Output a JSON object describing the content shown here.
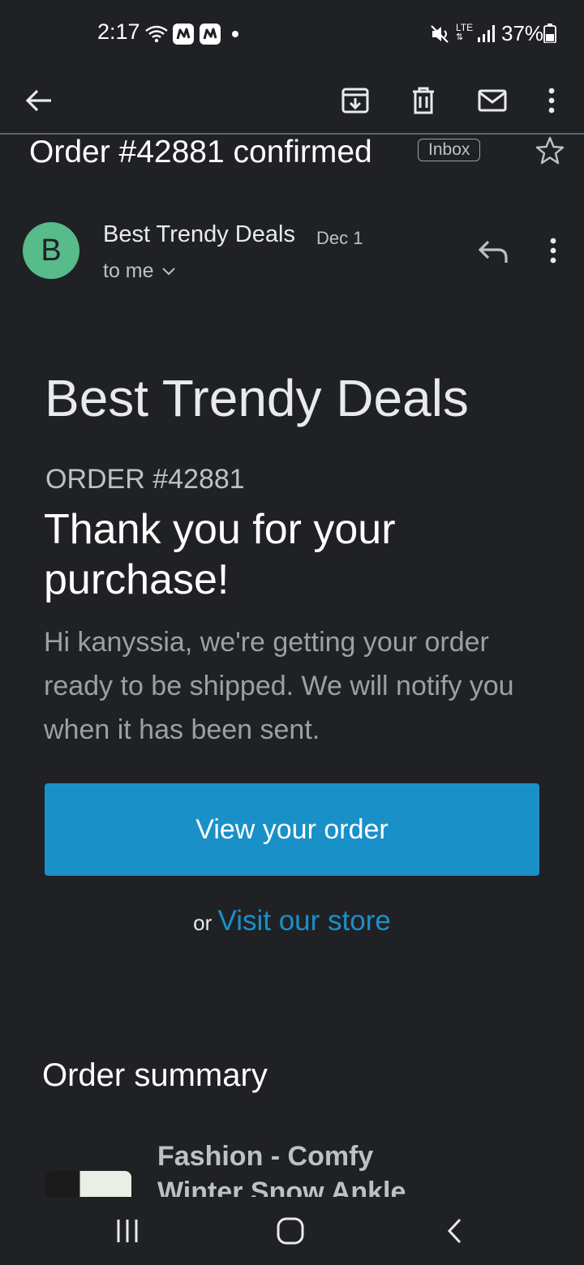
{
  "status_bar": {
    "time": "2:17",
    "network": "LTE",
    "battery": "37%",
    "icons": [
      "wifi-icon",
      "notification-app-icon",
      "notification-app-icon",
      "dot-icon",
      "mute-icon",
      "lte-icon",
      "signal-icon",
      "battery-icon"
    ]
  },
  "toolbar": {
    "back_icon": "arrow-left-icon",
    "actions": [
      "archive-icon",
      "delete-icon",
      "mark-unread-icon",
      "more-vert-icon"
    ]
  },
  "email": {
    "subject": "Order #42881 confirmed",
    "label": "Inbox",
    "sender": {
      "initial": "B",
      "name": "Best Trendy Deals",
      "date": "Dec 1",
      "recipient": "to me",
      "avatar_color": "#57bb8a"
    },
    "body": {
      "brand": "Best Trendy Deals",
      "order_number": "ORDER #42881",
      "heading": "Thank you for your purchase!",
      "intro": "Hi kanyssia, we're getting your order ready to be shipped. We will notify you when it has been sent.",
      "button_label": "View your order",
      "or_text": "or",
      "store_link": "Visit our store",
      "summary_heading": "Order summary",
      "product_name": "Fashion - Comfy Winter Snow Ankle"
    }
  },
  "colors": {
    "background": "#202124",
    "accent": "#1a90c8"
  }
}
